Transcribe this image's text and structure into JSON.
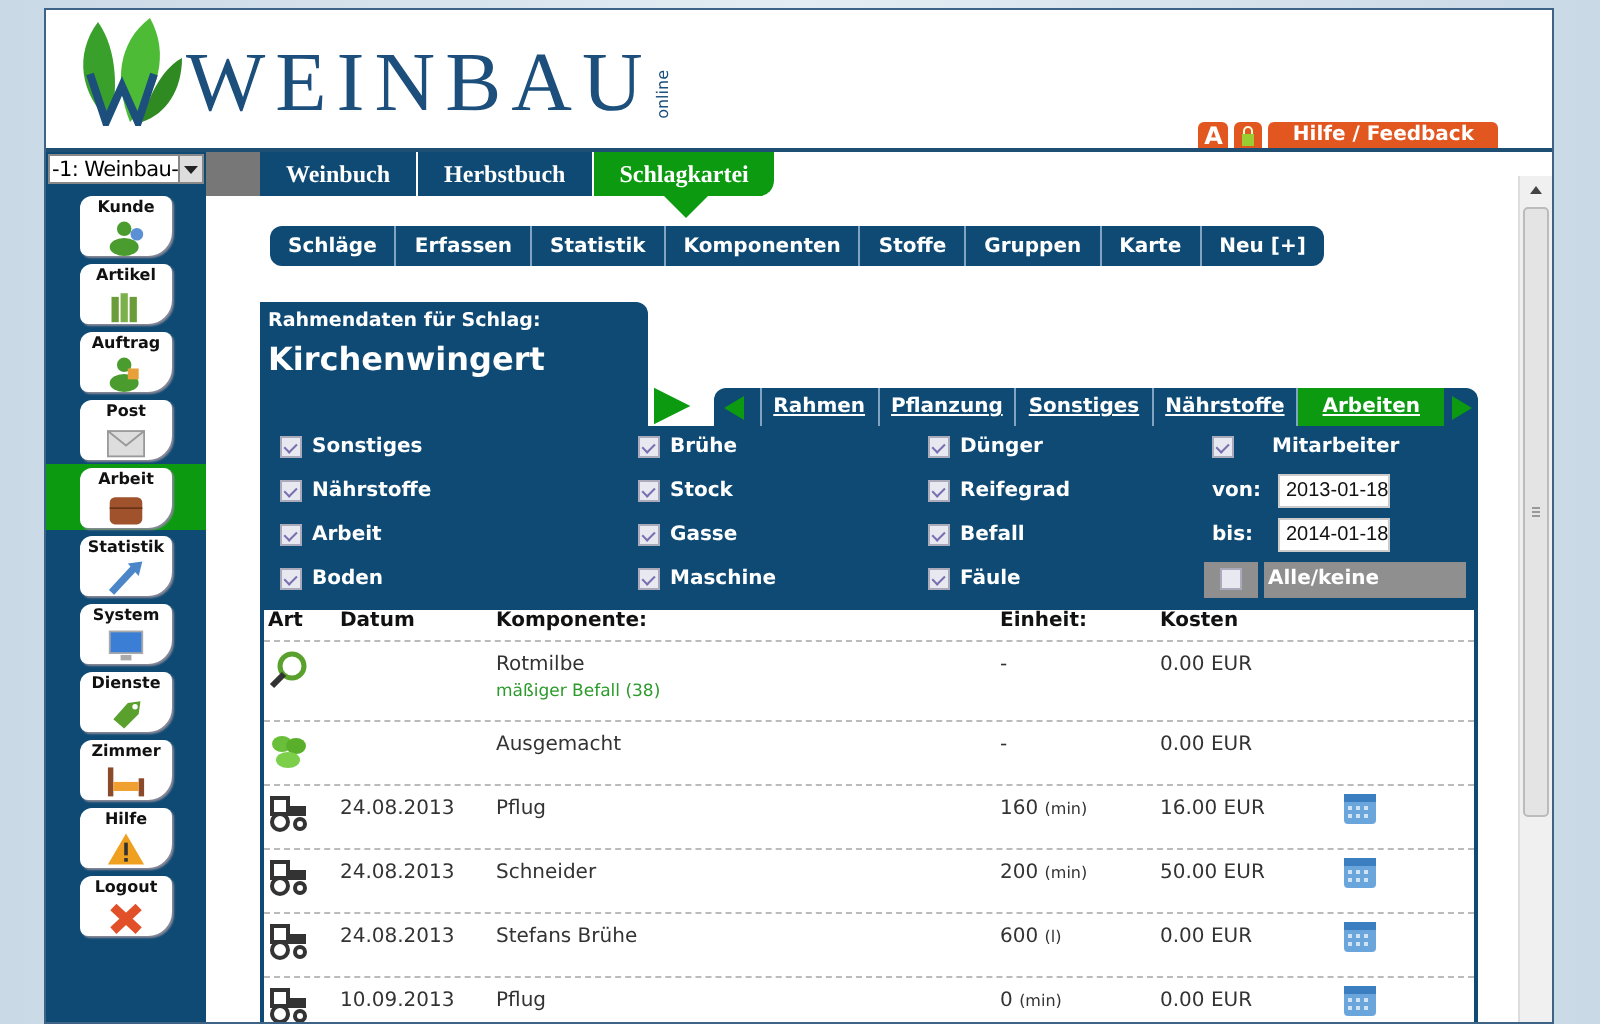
{
  "header": {
    "logo_text": "WEINBAU",
    "logo_suffix": "online",
    "buttons": [
      {
        "kind": "letter",
        "label": "A"
      },
      {
        "kind": "lock"
      },
      {
        "kind": "text",
        "label": "Hilfe / Feedback"
      }
    ]
  },
  "sidebar": {
    "select": "-1: Weinbau-",
    "items": [
      {
        "label": "Kunde",
        "selected": false
      },
      {
        "label": "Artikel",
        "selected": false
      },
      {
        "label": "Auftrag",
        "selected": false
      },
      {
        "label": "Post",
        "selected": false
      },
      {
        "label": "Arbeit",
        "selected": true
      },
      {
        "label": "Statistik",
        "selected": false
      },
      {
        "label": "System",
        "selected": false
      },
      {
        "label": "Dienste",
        "selected": false
      },
      {
        "label": "Zimmer",
        "selected": false
      },
      {
        "label": "Hilfe",
        "selected": false
      },
      {
        "label": "Logout",
        "selected": false
      }
    ]
  },
  "main_tabs": [
    {
      "label": "Weinbuch",
      "selected": false
    },
    {
      "label": "Herbstbuch",
      "selected": false
    },
    {
      "label": "Schlagkartei",
      "selected": true
    }
  ],
  "sub_tabs": [
    "Schläge",
    "Erfassen",
    "Statistik",
    "Komponenten",
    "Stoffe",
    "Gruppen",
    "Karte",
    "Neu [+]"
  ],
  "card": {
    "subtitle": "Rahmendaten für Schlag:",
    "title": "Kirchenwingert",
    "tabs": [
      {
        "label": "Rahmen",
        "selected": false
      },
      {
        "label": "Pflanzung",
        "selected": false
      },
      {
        "label": "Sonstiges",
        "selected": false
      },
      {
        "label": "Nährstoffe",
        "selected": false
      },
      {
        "label": "Arbeiten",
        "selected": true
      }
    ],
    "filters": [
      {
        "kind": "checkbox",
        "label": "Sonstiges",
        "checked": true
      },
      {
        "kind": "checkbox",
        "label": "Brühe",
        "checked": true
      },
      {
        "kind": "checkbox",
        "label": "Dünger",
        "checked": true
      },
      {
        "kind": "checkbox",
        "label": "Mitarbeiter",
        "checked": true
      },
      {
        "kind": "checkbox",
        "label": "Nährstoffe",
        "checked": true
      },
      {
        "kind": "checkbox",
        "label": "Stock",
        "checked": true
      },
      {
        "kind": "checkbox",
        "label": "Reifegrad",
        "checked": true
      },
      {
        "kind": "date",
        "label": "von:",
        "value": "2013-01-18"
      },
      {
        "kind": "checkbox",
        "label": "Arbeit",
        "checked": true
      },
      {
        "kind": "checkbox",
        "label": "Gasse",
        "checked": true
      },
      {
        "kind": "checkbox",
        "label": "Befall",
        "checked": true
      },
      {
        "kind": "date",
        "label": "bis:",
        "value": "2014-01-18"
      },
      {
        "kind": "checkbox",
        "label": "Boden",
        "checked": true
      },
      {
        "kind": "checkbox",
        "label": "Maschine",
        "checked": true
      },
      {
        "kind": "checkbox",
        "label": "Fäule",
        "checked": true
      },
      {
        "kind": "toggle",
        "label": "Alle/keine",
        "checked": false
      }
    ]
  },
  "table": {
    "columns": [
      "Art",
      "Datum",
      "Komponente:",
      "Einheit:",
      "Kosten"
    ],
    "rows": [
      {
        "kind": "inspection",
        "component": "Rotmilbe",
        "note": "mäßiger Befall (38)",
        "amount": "-",
        "cost": "0.00 EUR",
        "calendar": false
      },
      {
        "kind": "plant",
        "component": "Ausgemacht",
        "amount": "-",
        "cost": "0.00 EUR",
        "calendar": false
      },
      {
        "kind": "tractor",
        "date": "24.08.2013",
        "component": "Pflug",
        "amount": "160",
        "unit": "(min)",
        "cost": "16.00 EUR",
        "calendar": true
      },
      {
        "kind": "tractor",
        "date": "24.08.2013",
        "component": "Schneider",
        "amount": "200",
        "unit": "(min)",
        "cost": "50.00 EUR",
        "calendar": true
      },
      {
        "kind": "tractor",
        "date": "24.08.2013",
        "component": "Stefans Brühe",
        "amount": "600",
        "unit": "(l)",
        "cost": "0.00 EUR",
        "calendar": true
      },
      {
        "kind": "tractor",
        "date": "10.09.2013",
        "component": "Pflug",
        "amount": "0",
        "unit": "(min)",
        "cost": "0.00 EUR",
        "calendar": true
      }
    ]
  }
}
